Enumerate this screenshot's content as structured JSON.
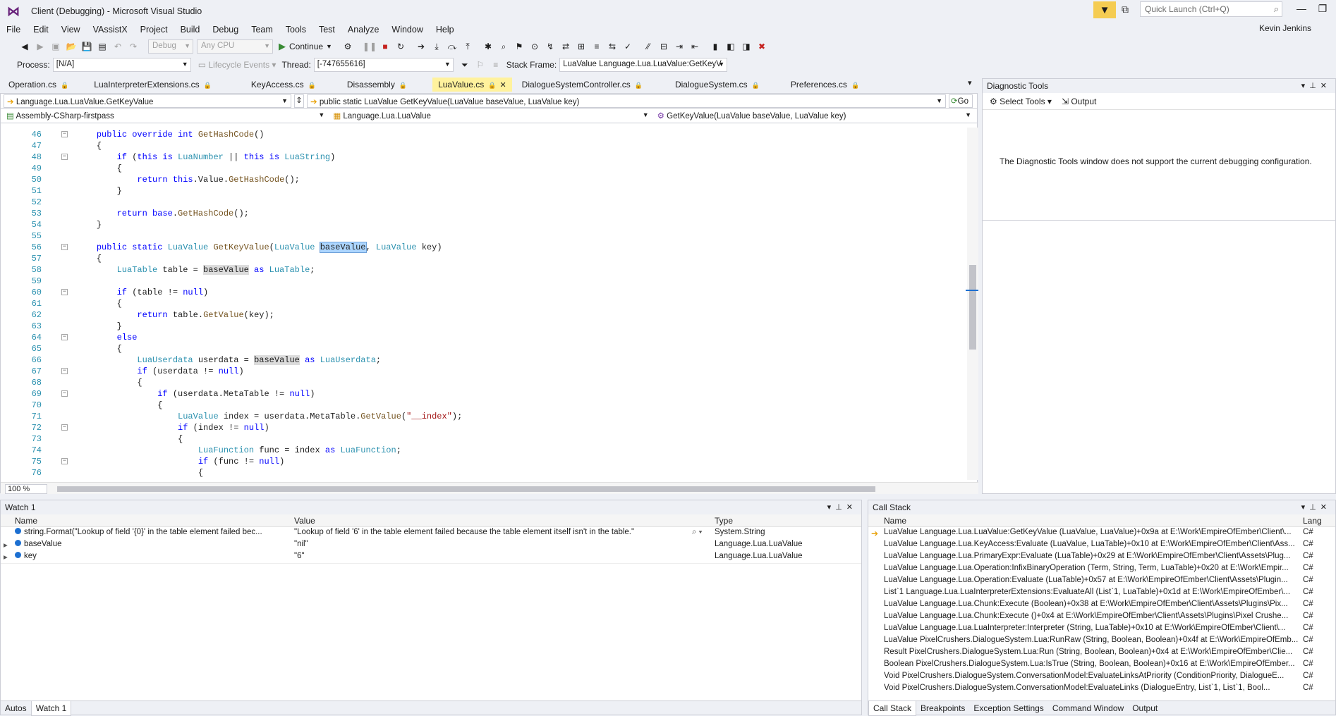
{
  "window": {
    "title": "Client (Debugging) - Microsoft Visual Studio",
    "quick_launch_placeholder": "Quick Launch (Ctrl+Q)",
    "user": "Kevin Jenkins"
  },
  "menu": [
    "File",
    "Edit",
    "View",
    "VAssistX",
    "Project",
    "Build",
    "Debug",
    "Team",
    "Tools",
    "Test",
    "Analyze",
    "Window",
    "Help"
  ],
  "toolbar": {
    "config": "Debug",
    "platform": "Any CPU",
    "continue_label": "Continue"
  },
  "debug_location": {
    "process_label": "Process:",
    "process": "[N/A]",
    "lifecycle": "Lifecycle Events",
    "thread_label": "Thread:",
    "thread": "[-747655616]",
    "stack_frame_label": "Stack Frame:",
    "stack_frame": "LuaValue Language.Lua.LuaValue:GetKeyV"
  },
  "tabs": [
    {
      "label": "Operation.cs",
      "active": false
    },
    {
      "label": "LuaInterpreterExtensions.cs",
      "active": false
    },
    {
      "label": "KeyAccess.cs",
      "active": false
    },
    {
      "label": "Disassembly",
      "active": false
    },
    {
      "label": "LuaValue.cs",
      "active": true
    },
    {
      "label": "DialogueSystemController.cs",
      "active": false
    },
    {
      "label": "DialogueSystem.cs",
      "active": false
    },
    {
      "label": "Preferences.cs",
      "active": false
    }
  ],
  "editor": {
    "nav_left": "Language.Lua.LuaValue.GetKeyValue",
    "nav_right": "public static LuaValue GetKeyValue(LuaValue baseValue, LuaValue key)",
    "go_label": "Go",
    "project": "Assembly-CSharp-firstpass",
    "type": "Language.Lua.LuaValue",
    "member": "GetKeyValue(LuaValue baseValue, LuaValue key)",
    "zoom": "100 %",
    "lines": [
      {
        "n": "46",
        "fold": "-",
        "html": "    <span class=\"kw\">public override int</span> <span class=\"mt\">GetHashCode</span>()"
      },
      {
        "n": "47",
        "fold": "",
        "html": "    {"
      },
      {
        "n": "48",
        "fold": "-",
        "html": "        <span class=\"kw\">if</span> (<span class=\"kw\">this is</span> <span class=\"ty\">LuaNumber</span> || <span class=\"kw\">this is</span> <span class=\"ty\">LuaString</span>)"
      },
      {
        "n": "49",
        "fold": "",
        "html": "        {"
      },
      {
        "n": "50",
        "fold": "",
        "html": "            <span class=\"kw\">return this</span>.Value.<span class=\"mt\">GetHashCode</span>();"
      },
      {
        "n": "51",
        "fold": "",
        "html": "        }"
      },
      {
        "n": "52",
        "fold": "",
        "html": ""
      },
      {
        "n": "53",
        "fold": "",
        "html": "        <span class=\"kw\">return base</span>.<span class=\"mt\">GetHashCode</span>();"
      },
      {
        "n": "54",
        "fold": "",
        "html": "    }"
      },
      {
        "n": "55",
        "fold": "",
        "html": ""
      },
      {
        "n": "56",
        "fold": "-",
        "html": "    <span class=\"kw\">public static</span> <span class=\"ty\">LuaValue</span> <span class=\"mt\">GetKeyValue</span>(<span class=\"ty\">LuaValue</span> <span class=\"sel\">baseValue</span>, <span class=\"ty\">LuaValue</span> key)"
      },
      {
        "n": "57",
        "fold": "",
        "html": "    {"
      },
      {
        "n": "58",
        "fold": "",
        "html": "        <span class=\"ty\">LuaTable</span> table = <span class=\"hl\">baseValue</span> <span class=\"kw\">as</span> <span class=\"ty\">LuaTable</span>;"
      },
      {
        "n": "59",
        "fold": "",
        "html": ""
      },
      {
        "n": "60",
        "fold": "-",
        "html": "        <span class=\"kw\">if</span> (table != <span class=\"kw\">null</span>)"
      },
      {
        "n": "61",
        "fold": "",
        "html": "        {"
      },
      {
        "n": "62",
        "fold": "",
        "html": "            <span class=\"kw\">return</span> table.<span class=\"mt\">GetValue</span>(key);"
      },
      {
        "n": "63",
        "fold": "",
        "html": "        }"
      },
      {
        "n": "64",
        "fold": "-",
        "html": "        <span class=\"kw\">else</span>"
      },
      {
        "n": "65",
        "fold": "",
        "html": "        {"
      },
      {
        "n": "66",
        "fold": "",
        "html": "            <span class=\"ty\">LuaUserdata</span> userdata = <span class=\"hl\">baseValue</span> <span class=\"kw\">as</span> <span class=\"ty\">LuaUserdata</span>;"
      },
      {
        "n": "67",
        "fold": "-",
        "html": "            <span class=\"kw\">if</span> (userdata != <span class=\"kw\">null</span>)"
      },
      {
        "n": "68",
        "fold": "",
        "html": "            {"
      },
      {
        "n": "69",
        "fold": "-",
        "html": "                <span class=\"kw\">if</span> (userdata.MetaTable != <span class=\"kw\">null</span>)"
      },
      {
        "n": "70",
        "fold": "",
        "html": "                {"
      },
      {
        "n": "71",
        "fold": "",
        "html": "                    <span class=\"ty\">LuaValue</span> index = userdata.MetaTable.<span class=\"mt\">GetValue</span>(<span class=\"st\">\"__index\"</span>);"
      },
      {
        "n": "72",
        "fold": "-",
        "html": "                    <span class=\"kw\">if</span> (index != <span class=\"kw\">null</span>)"
      },
      {
        "n": "73",
        "fold": "",
        "html": "                    {"
      },
      {
        "n": "74",
        "fold": "",
        "html": "                        <span class=\"ty\">LuaFunction</span> func = index <span class=\"kw\">as</span> <span class=\"ty\">LuaFunction</span>;"
      },
      {
        "n": "75",
        "fold": "-",
        "html": "                        <span class=\"kw\">if</span> (func != <span class=\"kw\">null</span>)"
      },
      {
        "n": "76",
        "fold": "",
        "html": "                        {"
      }
    ]
  },
  "diagnostic": {
    "title": "Diagnostic Tools",
    "select_tools": "Select Tools",
    "output": "Output",
    "message": "The Diagnostic Tools window does not support the current debugging configuration."
  },
  "watch": {
    "title": "Watch 1",
    "columns": [
      "Name",
      "Value",
      "Type"
    ],
    "rows": [
      {
        "name": "string.Format(\"Lookup of field '{0}' in the table element failed bec...",
        "value": "\"Lookup of field '6' in the table element failed because the table element itself isn't in the table.\"",
        "type": "System.String"
      },
      {
        "name": "baseValue",
        "value": "\"nil\"",
        "type": "Language.Lua.LuaValue"
      },
      {
        "name": "key",
        "value": "\"6\"",
        "type": "Language.Lua.LuaValue"
      }
    ],
    "tabs": [
      "Autos",
      "Watch 1"
    ]
  },
  "callstack": {
    "title": "Call Stack",
    "columns": [
      "Name",
      "Lang"
    ],
    "rows": [
      {
        "name": "LuaValue Language.Lua.LuaValue:GetKeyValue (LuaValue, LuaValue)+0x9a at E:\\Work\\EmpireOfEmber\\Client\\...",
        "lang": "C#"
      },
      {
        "name": "LuaValue Language.Lua.KeyAccess:Evaluate (LuaValue, LuaTable)+0x10 at E:\\Work\\EmpireOfEmber\\Client\\Ass...",
        "lang": "C#"
      },
      {
        "name": "LuaValue Language.Lua.PrimaryExpr:Evaluate (LuaTable)+0x29 at E:\\Work\\EmpireOfEmber\\Client\\Assets\\Plug...",
        "lang": "C#"
      },
      {
        "name": "LuaValue Language.Lua.Operation:InfixBinaryOperation (Term, String, Term, LuaTable)+0x20 at E:\\Work\\Empir...",
        "lang": "C#"
      },
      {
        "name": "LuaValue Language.Lua.Operation:Evaluate (LuaTable)+0x57 at E:\\Work\\EmpireOfEmber\\Client\\Assets\\Plugin...",
        "lang": "C#"
      },
      {
        "name": "List`1 Language.Lua.LuaInterpreterExtensions:EvaluateAll (List`1, LuaTable)+0x1d at E:\\Work\\EmpireOfEmber\\...",
        "lang": "C#"
      },
      {
        "name": "LuaValue Language.Lua.Chunk:Execute (Boolean)+0x38 at E:\\Work\\EmpireOfEmber\\Client\\Assets\\Plugins\\Pix...",
        "lang": "C#"
      },
      {
        "name": "LuaValue Language.Lua.Chunk:Execute ()+0x4 at E:\\Work\\EmpireOfEmber\\Client\\Assets\\Plugins\\Pixel Crushe...",
        "lang": "C#"
      },
      {
        "name": "LuaValue Language.Lua.LuaInterpreter:Interpreter (String, LuaTable)+0x10 at E:\\Work\\EmpireOfEmber\\Client\\...",
        "lang": "C#"
      },
      {
        "name": "LuaValue PixelCrushers.DialogueSystem.Lua:RunRaw (String, Boolean, Boolean)+0x4f at E:\\Work\\EmpireOfEmb...",
        "lang": "C#"
      },
      {
        "name": "Result PixelCrushers.DialogueSystem.Lua:Run (String, Boolean, Boolean)+0x4 at E:\\Work\\EmpireOfEmber\\Clie...",
        "lang": "C#"
      },
      {
        "name": "Boolean PixelCrushers.DialogueSystem.Lua:IsTrue (String, Boolean, Boolean)+0x16 at E:\\Work\\EmpireOfEmber...",
        "lang": "C#"
      },
      {
        "name": "Void PixelCrushers.DialogueSystem.ConversationModel:EvaluateLinksAtPriority (ConditionPriority, DialogueE...",
        "lang": "C#"
      },
      {
        "name": "Void PixelCrushers.DialogueSystem.ConversationModel:EvaluateLinks (DialogueEntry, List`1, List`1, Bool...",
        "lang": "C#"
      }
    ],
    "tabs": [
      "Call Stack",
      "Breakpoints",
      "Exception Settings",
      "Command Window",
      "Output"
    ]
  }
}
